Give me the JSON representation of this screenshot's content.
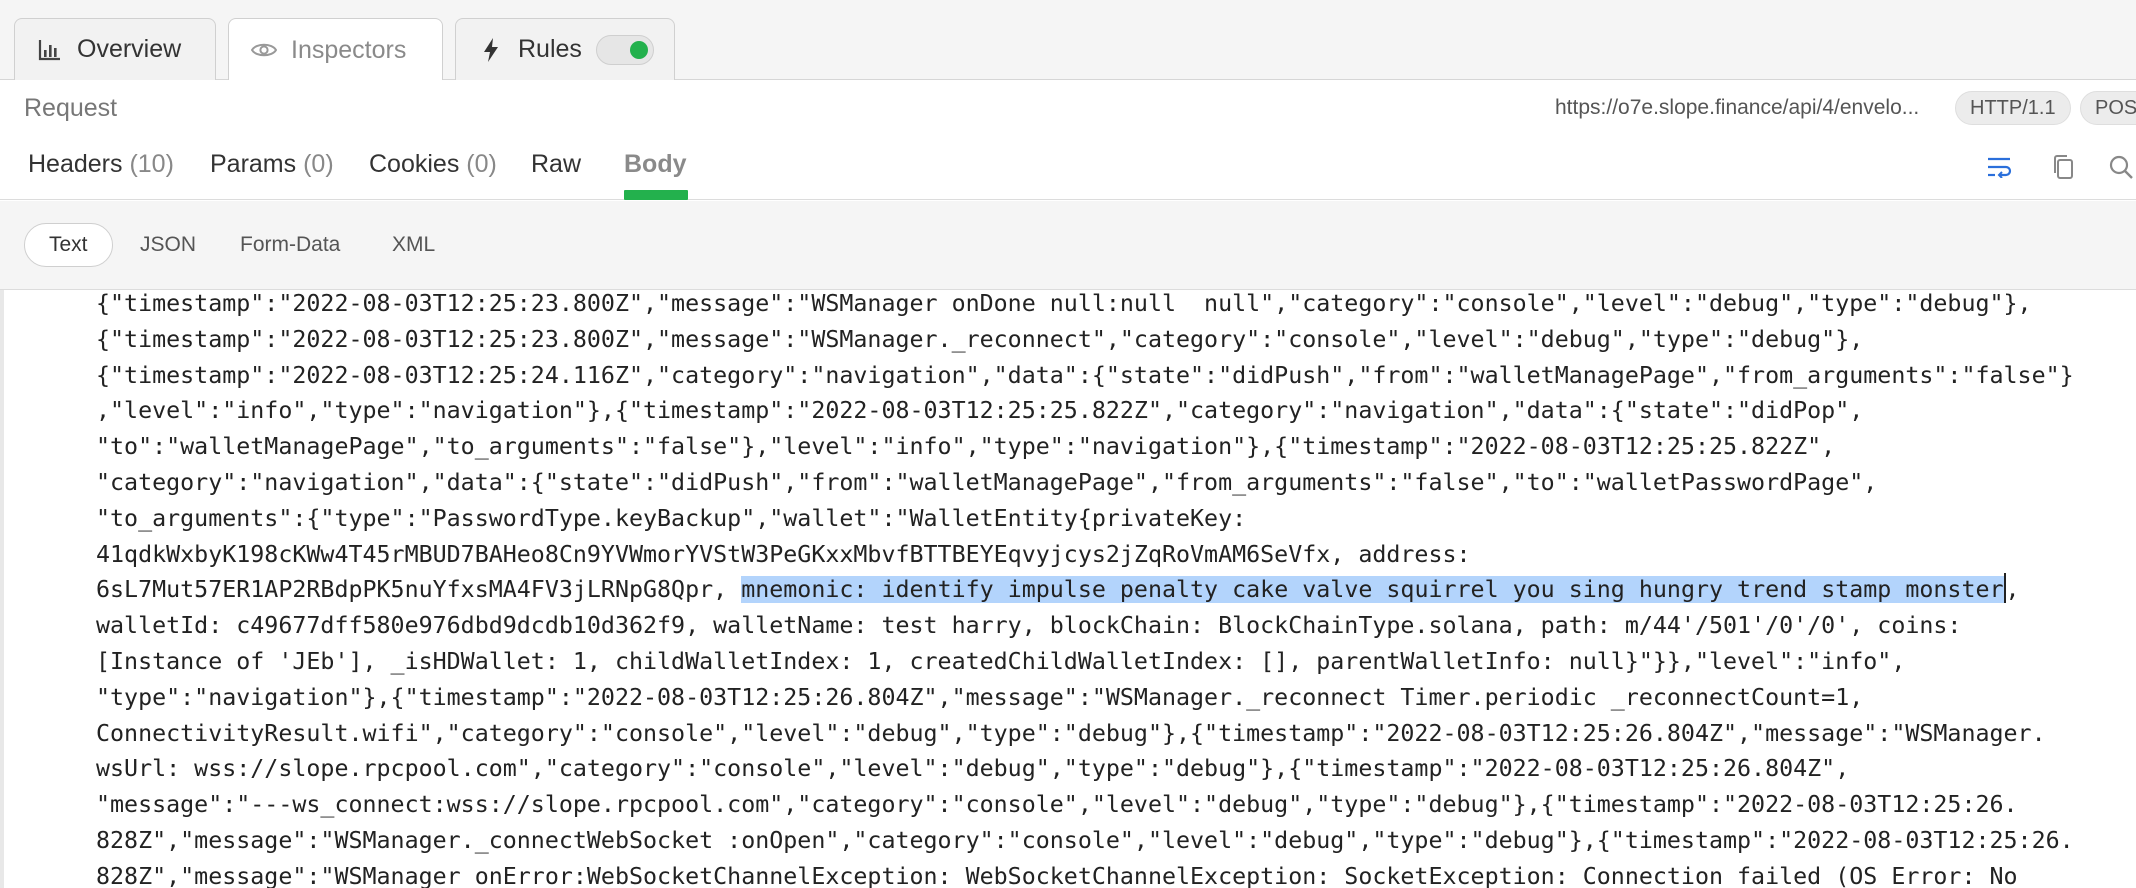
{
  "tabs": [
    {
      "label": "Overview",
      "icon": "bar-chart-icon"
    },
    {
      "label": "Inspectors",
      "icon": "eye-icon"
    },
    {
      "label": "Rules",
      "icon": "lightning-icon",
      "toggle": "on"
    }
  ],
  "request": {
    "label": "Request",
    "url": "https://o7e.slope.finance/api/4/envelo...",
    "protocol": "HTTP/1.1",
    "method": "POST"
  },
  "subtabs": [
    {
      "label": "Headers",
      "count": "(10)"
    },
    {
      "label": "Params",
      "count": "(0)"
    },
    {
      "label": "Cookies",
      "count": "(0)"
    },
    {
      "label": "Raw",
      "count": ""
    },
    {
      "label": "Body",
      "count": ""
    }
  ],
  "formats": [
    "Text",
    "JSON",
    "Form-Data",
    "XML"
  ],
  "body": {
    "lines": [
      "{\"timestamp\":\"2022-08-03T12:25:23.800Z\",\"message\":\"WSManager onDone null:null  null\",\"category\":\"console\",\"level\":\"debug\",\"type\":\"debug\"},",
      "{\"timestamp\":\"2022-08-03T12:25:23.800Z\",\"message\":\"WSManager._reconnect\",\"category\":\"console\",\"level\":\"debug\",\"type\":\"debug\"},",
      "{\"timestamp\":\"2022-08-03T12:25:24.116Z\",\"category\":\"navigation\",\"data\":{\"state\":\"didPush\",\"from\":\"walletManagePage\",\"from_arguments\":\"false\"}",
      ",\"level\":\"info\",\"type\":\"navigation\"},{\"timestamp\":\"2022-08-03T12:25:25.822Z\",\"category\":\"navigation\",\"data\":{\"state\":\"didPop\",",
      "\"to\":\"walletManagePage\",\"to_arguments\":\"false\"},\"level\":\"info\",\"type\":\"navigation\"},{\"timestamp\":\"2022-08-03T12:25:25.822Z\",",
      "\"category\":\"navigation\",\"data\":{\"state\":\"didPush\",\"from\":\"walletManagePage\",\"from_arguments\":\"false\",\"to\":\"walletPasswordPage\",",
      "\"to_arguments\":{\"type\":\"PasswordType.keyBackup\",\"wallet\":\"WalletEntity{privateKey:",
      "41qdkWxbyK198cKWw4T45rMBUD7BAHeo8Cn9YVWmorYVStW3PeGKxxMbvfBTTBEYEqvyjcys2jZqRoVmAM6SeVfx, address:"
    ],
    "mnemonic_line_prefix": "6sL7Mut57ER1AP2RBdpPK5nuYfxsMA4FV3jLRNpG8Qpr, ",
    "mnemonic_highlight": "mnemonic: identify impulse penalty cake valve squirrel you sing hungry trend stamp monster",
    "mnemonic_line_suffix": ",",
    "lines_after": [
      "walletId: c49677dff580e976dbd9dcdb10d362f9, walletName: test harry, blockChain: BlockChainType.solana, path: m/44'/501'/0'/0', coins:",
      "[Instance of 'JEb'], _isHDWallet: 1, childWalletIndex: 1, createdChildWalletIndex: [], parentWalletInfo: null}\"}},\"level\":\"info\",",
      "\"type\":\"navigation\"},{\"timestamp\":\"2022-08-03T12:25:26.804Z\",\"message\":\"WSManager._reconnect Timer.periodic _reconnectCount=1,",
      "ConnectivityResult.wifi\",\"category\":\"console\",\"level\":\"debug\",\"type\":\"debug\"},{\"timestamp\":\"2022-08-03T12:25:26.804Z\",\"message\":\"WSManager.",
      "wsUrl: wss://slope.rpcpool.com\",\"category\":\"console\",\"level\":\"debug\",\"type\":\"debug\"},{\"timestamp\":\"2022-08-03T12:25:26.804Z\",",
      "\"message\":\"---ws_connect:wss://slope.rpcpool.com\",\"category\":\"console\",\"level\":\"debug\",\"type\":\"debug\"},{\"timestamp\":\"2022-08-03T12:25:26.",
      "828Z\",\"message\":\"WSManager._connectWebSocket :onOpen\",\"category\":\"console\",\"level\":\"debug\",\"type\":\"debug\"},{\"timestamp\":\"2022-08-03T12:25:26.",
      "828Z\",\"message\":\"WSManager onError:WebSocketChannelException: WebSocketChannelException: SocketException: Connection failed (OS Error: No"
    ]
  },
  "colors": {
    "accent": "#23b14d",
    "highlight": "#b3d4fc",
    "toolIcon": "#2a6fdb"
  }
}
